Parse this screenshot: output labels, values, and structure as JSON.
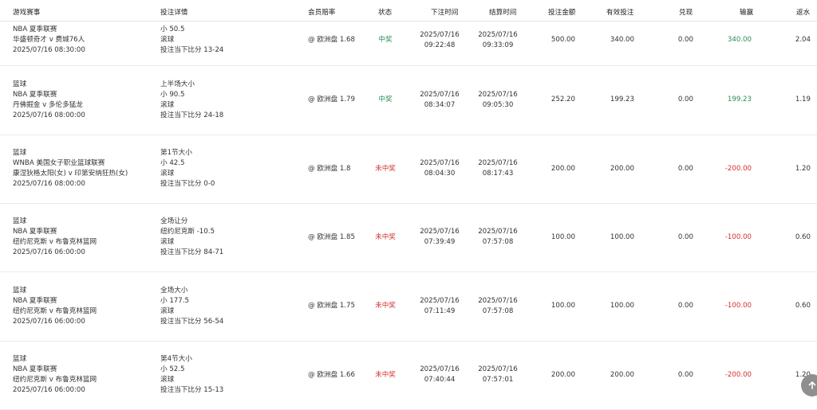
{
  "header": {
    "game": "游戏赛事",
    "details": "投注详情",
    "odds": "会员赔率",
    "status": "状态",
    "bet_time": "下注时间",
    "settle_time": "结算时间",
    "amount": "投注金额",
    "valid": "有效投注",
    "cashout": "兑现",
    "winloss": "输赢",
    "rebate": "返水"
  },
  "rows": [
    {
      "game": [
        "NBA 夏季联赛",
        "华盛顿奇才 v 费城76人",
        "2025/07/16 08:30:00"
      ],
      "details": [
        "小 50.5",
        "滚球",
        "投注当下比分 13-24"
      ],
      "odds": "@ 欧洲盘 1.68",
      "status": "中奖",
      "status_type": "win",
      "bet_time": [
        "2025/07/16",
        "09:22:48"
      ],
      "settle_time": [
        "2025/07/16",
        "09:33:09"
      ],
      "amount": "500.00",
      "valid": "340.00",
      "cashout": "0.00",
      "winloss": "340.00",
      "rebate": "2.04"
    },
    {
      "game": [
        "篮球",
        "NBA 夏季联赛",
        "丹佛掘金 v 多伦多猛龙",
        "2025/07/16 08:00:00"
      ],
      "details": [
        "上半场大小",
        "小 90.5",
        "滚球",
        "投注当下比分 24-18"
      ],
      "odds": "@ 欧洲盘 1.79",
      "status": "中奖",
      "status_type": "win",
      "bet_time": [
        "2025/07/16",
        "08:34:07"
      ],
      "settle_time": [
        "2025/07/16",
        "09:05:30"
      ],
      "amount": "252.20",
      "valid": "199.23",
      "cashout": "0.00",
      "winloss": "199.23",
      "rebate": "1.19"
    },
    {
      "game": [
        "篮球",
        "WNBA 美国女子职业篮球联赛",
        "康涅狄格太阳(女) v 印第安纳狂热(女)",
        "2025/07/16 08:00:00"
      ],
      "details": [
        "第1节大小",
        "小 42.5",
        "滚球",
        "投注当下比分 0-0"
      ],
      "odds": "@ 欧洲盘 1.8",
      "status": "未中奖",
      "status_type": "lose",
      "bet_time": [
        "2025/07/16",
        "08:04:30"
      ],
      "settle_time": [
        "2025/07/16",
        "08:17:43"
      ],
      "amount": "200.00",
      "valid": "200.00",
      "cashout": "0.00",
      "winloss": "-200.00",
      "rebate": "1.20"
    },
    {
      "game": [
        "篮球",
        "NBA 夏季联赛",
        "纽约尼克斯 v 布鲁克林篮网",
        "2025/07/16 06:00:00"
      ],
      "details": [
        "全场让分",
        "纽约尼克斯 -10.5",
        "滚球",
        "投注当下比分 84-71"
      ],
      "odds": "@ 欧洲盘 1.85",
      "status": "未中奖",
      "status_type": "lose",
      "bet_time": [
        "2025/07/16",
        "07:39:49"
      ],
      "settle_time": [
        "2025/07/16",
        "07:57:08"
      ],
      "amount": "100.00",
      "valid": "100.00",
      "cashout": "0.00",
      "winloss": "-100.00",
      "rebate": "0.60"
    },
    {
      "game": [
        "篮球",
        "NBA 夏季联赛",
        "纽约尼克斯 v 布鲁克林篮网",
        "2025/07/16 06:00:00"
      ],
      "details": [
        "全场大小",
        "小 177.5",
        "滚球",
        "投注当下比分 56-54"
      ],
      "odds": "@ 欧洲盘 1.75",
      "status": "未中奖",
      "status_type": "lose",
      "bet_time": [
        "2025/07/16",
        "07:11:49"
      ],
      "settle_time": [
        "2025/07/16",
        "07:57:08"
      ],
      "amount": "100.00",
      "valid": "100.00",
      "cashout": "0.00",
      "winloss": "-100.00",
      "rebate": "0.60"
    },
    {
      "game": [
        "篮球",
        "NBA 夏季联赛",
        "纽约尼克斯 v 布鲁克林篮网",
        "2025/07/16 06:00:00"
      ],
      "details": [
        "第4节大小",
        "小 52.5",
        "滚球",
        "投注当下比分 15-13"
      ],
      "odds": "@ 欧洲盘 1.66",
      "status": "未中奖",
      "status_type": "lose",
      "bet_time": [
        "2025/07/16",
        "07:40:44"
      ],
      "settle_time": [
        "2025/07/16",
        "07:57:01"
      ],
      "amount": "200.00",
      "valid": "200.00",
      "cashout": "0.00",
      "winloss": "-200.00",
      "rebate": "1.20"
    }
  ],
  "colors": {
    "win": "#2e8b57",
    "lose": "#d32f2f"
  },
  "scroll_top_icon": "arrow-up-icon"
}
